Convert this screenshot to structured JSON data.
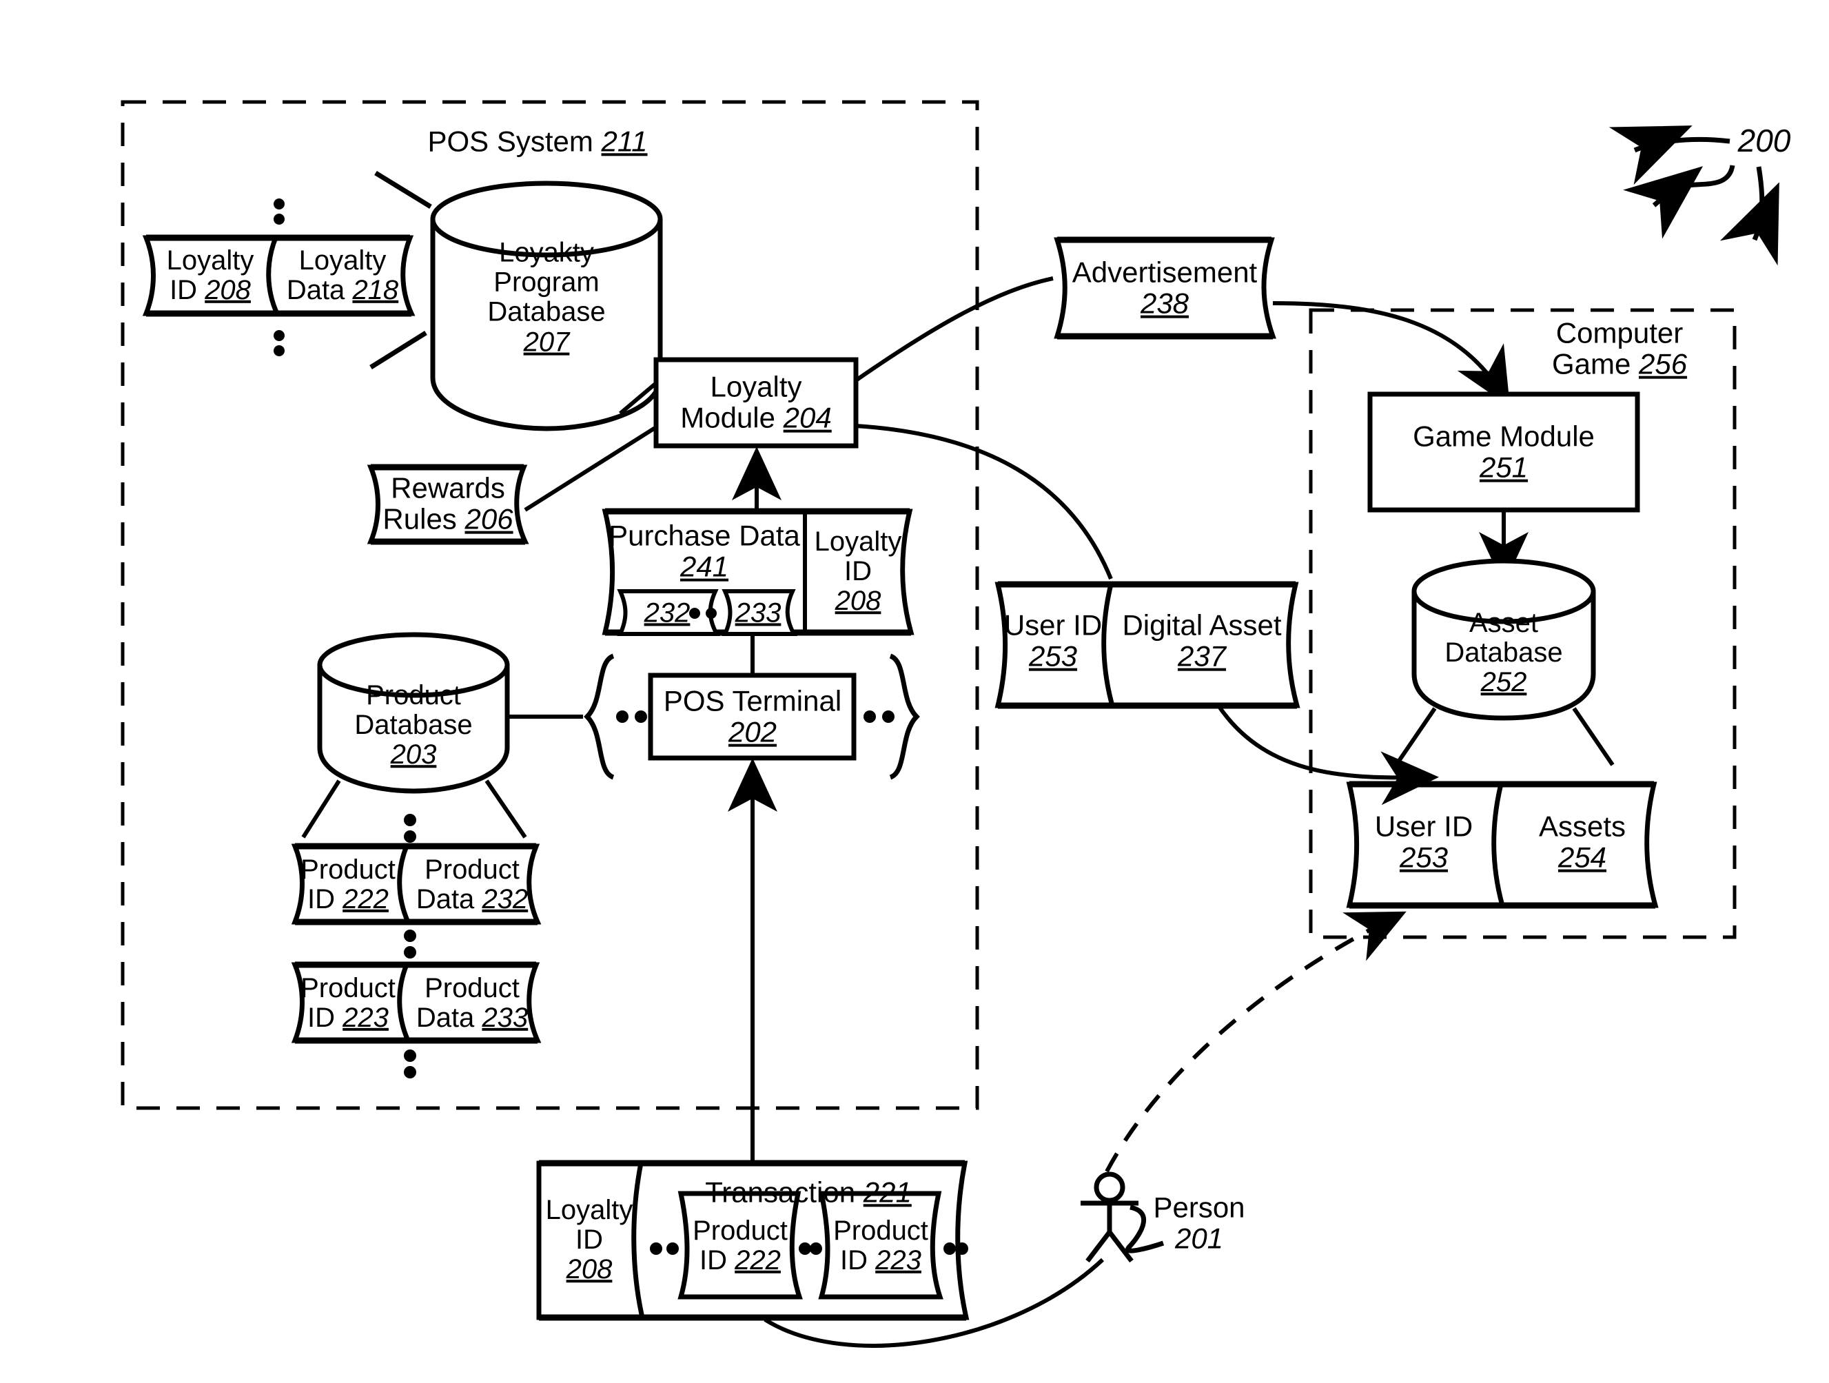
{
  "figure": {
    "number": "200"
  },
  "containers": {
    "pos_system": {
      "label": "POS System",
      "number": "211"
    },
    "computer_game": {
      "label": "Computer\nGame",
      "number": "256"
    }
  },
  "nodes": {
    "loyalty_id_record": {
      "left": "Loyalty\nID",
      "left_number": "208",
      "right": "Loyalty\nData",
      "right_number": "218"
    },
    "loyalty_program_database": {
      "label": "Loyakty\nProgram\nDatabase",
      "number": "207"
    },
    "loyalty_module": {
      "label": "Loyalty\nModule",
      "number": "204"
    },
    "rewards_rules": {
      "label": "Rewards\nRules",
      "number": "206"
    },
    "purchase_data": {
      "label": "Purchase Data",
      "number": "241",
      "item_a": "232",
      "item_b": "233",
      "ellipsis": "• •"
    },
    "loyalty_id_field": {
      "label": "Loyalty\nID",
      "number": "208"
    },
    "product_database": {
      "label": "Product\nDatabase",
      "number": "203"
    },
    "pos_terminal": {
      "label": "POS Terminal",
      "number": "202",
      "ellipsis_left": "• •",
      "ellipsis_right": "• •"
    },
    "product_record_1": {
      "left": "Product\nID",
      "left_number": "222",
      "right": "Product\nData",
      "right_number": "232"
    },
    "product_record_2": {
      "left": "Product\nID",
      "left_number": "223",
      "right": "Product\nData",
      "right_number": "233"
    },
    "advertisement": {
      "label": "Advertisement",
      "number": "238"
    },
    "digital_asset_record": {
      "left": "User ID",
      "left_number": "253",
      "right": "Digital Asset",
      "right_number": "237"
    },
    "game_module": {
      "label": "Game Module",
      "number": "251"
    },
    "asset_database": {
      "label": "Asset\nDatabase",
      "number": "252"
    },
    "assets_record": {
      "left": "User ID",
      "left_number": "253",
      "right": "Assets",
      "right_number": "254"
    },
    "transaction": {
      "label": "Transaction",
      "number": "221"
    },
    "transaction_loyalty_id": {
      "label": "Loyalty\nID",
      "number": "208"
    },
    "transaction_product_1": {
      "label": "Product\nID",
      "number": "222"
    },
    "transaction_product_2": {
      "label": "Product\nID",
      "number": "223"
    },
    "person": {
      "label": "Person",
      "number": "201"
    }
  },
  "colors": {
    "stroke": "#000000",
    "background": "#ffffff"
  }
}
